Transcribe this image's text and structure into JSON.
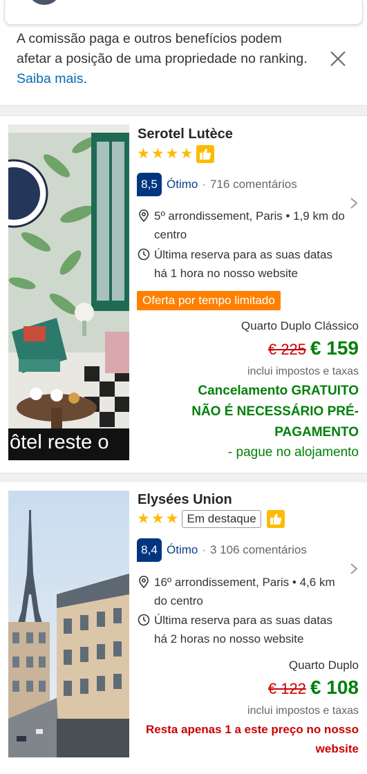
{
  "notice": {
    "text": "A comissão paga e outros benefícios podem afetar a posição de uma propriedade no ranking. ",
    "link": "Saiba mais",
    "end": "."
  },
  "hotels": [
    {
      "name": "Serotel Lutèce",
      "stars": 4,
      "featured": "",
      "score": "8,5",
      "score_word": "Ótimo",
      "reviews": "716 comentários",
      "location": "5º arrondissement, Paris • 1,9 km do centro",
      "last_booking": "Última reserva para as suas datas há 1 hora no nosso website",
      "offer": "Oferta por tempo limitado",
      "room": "Quarto Duplo Clássico",
      "old_price": "€ 225",
      "price": "€ 159",
      "taxes": "inclui impostos e taxas",
      "cancel": "Cancelamento GRATUITO NÃO É NECESSÁRIO PRÉ-PAGAMENTO",
      "pay_hotel": "- pague no alojamento",
      "photo_caption": "ôtel reste o"
    },
    {
      "name": "Elysées Union",
      "stars": 3,
      "featured": "Em destaque",
      "score": "8,4",
      "score_word": "Ótimo",
      "reviews": "3 106 comentários",
      "location": "16º arrondissement, Paris • 4,6 km do centro",
      "last_booking": "Última reserva para as suas datas há 2 horas no nosso website",
      "room": "Quarto Duplo",
      "old_price": "€ 122",
      "price": "€ 108",
      "taxes": "inclui impostos e taxas",
      "scarcity": "Resta apenas 1 a este preço no nosso website"
    }
  ],
  "icons": {
    "close": "close-icon",
    "pin": "location-pin-icon",
    "clock": "clock-icon",
    "thumb": "thumbs-up-icon",
    "chevron": "chevron-right-icon"
  },
  "colors": {
    "brand_blue": "#003580",
    "green": "#008009",
    "red": "#cc0000",
    "orange": "#ff8000",
    "star": "#febb02"
  }
}
